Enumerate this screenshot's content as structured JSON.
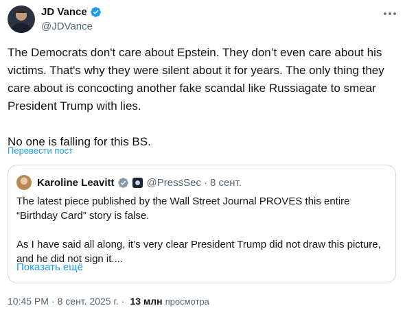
{
  "author": {
    "name": "JD Vance",
    "handle": "@JDVance"
  },
  "tweet": {
    "text": "The Democrats don't care about Epstein. They don’t even care about his victims. That's why they were silent about it for years. The only thing they care about is concocting another fake scandal like Russiagate to smear President Trump with lies.\n\nNo one is falling for this BS.",
    "translate_label": "Перевести пост"
  },
  "quote": {
    "name": "Karoline Leavitt",
    "handle": "@PressSec",
    "dot": "·",
    "date": "8 сент.",
    "text": "The latest piece published by the Wall Street Journal PROVES this entire “Birthday Card” story is false.\n\nAs I have said all along, it’s very clear President Trump did not draw this picture, and he did not sign it....",
    "show_more": "Показать ещё"
  },
  "meta": {
    "time": "10:45 PM",
    "sep": "·",
    "date": "8 сент. 2025 г.",
    "sep2": "·",
    "views_count": "13 млн",
    "views_label": "просмотра"
  },
  "colors": {
    "verified": "#1d9bf0",
    "link": "#1d9bf0",
    "secondary_text": "#536471",
    "primary_text": "#0f1419",
    "border": "#cfd9de"
  },
  "icons": {
    "verified": "verified-badge-icon",
    "more": "more-horizontal-icon",
    "affiliation": "white-house-affiliation-icon"
  }
}
